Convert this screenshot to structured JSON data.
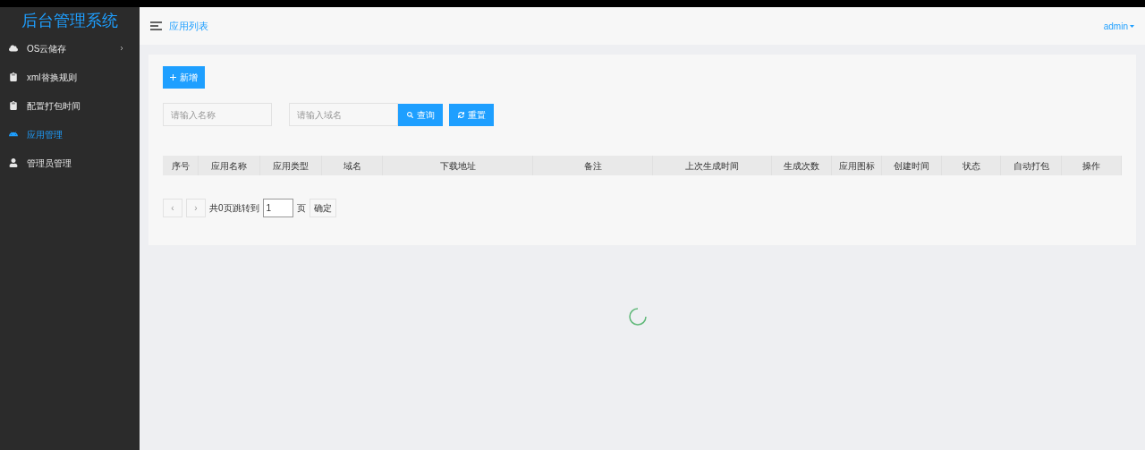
{
  "sidebar": {
    "title": "后台管理系统",
    "items": [
      {
        "label": "OS云储存",
        "selected": false,
        "has_submenu": true
      },
      {
        "label": "xml替换规则",
        "selected": false,
        "has_submenu": false
      },
      {
        "label": "配置打包时间",
        "selected": false,
        "has_submenu": false
      },
      {
        "label": "应用管理",
        "selected": true,
        "has_submenu": false
      },
      {
        "label": "管理员管理",
        "selected": false,
        "has_submenu": false
      }
    ]
  },
  "header": {
    "breadcrumb": "应用列表",
    "user": "admin"
  },
  "toolbar": {
    "add_button": "新增"
  },
  "filters": {
    "name_placeholder": "请输入名称",
    "domain_placeholder": "请输入域名",
    "search_button": "查询",
    "reset_button": "重置"
  },
  "table": {
    "columns": [
      "序号",
      "应用名称",
      "应用类型",
      "域名",
      "下载地址",
      "备注",
      "上次生成时间",
      "生成次数",
      "应用图标",
      "创建时间",
      "状态",
      "自动打包",
      "操作"
    ]
  },
  "pagination": {
    "prev": "‹",
    "next": "›",
    "total_text": "共0页跳转到",
    "page_value": "1",
    "page_unit": "页",
    "confirm": "确定"
  }
}
